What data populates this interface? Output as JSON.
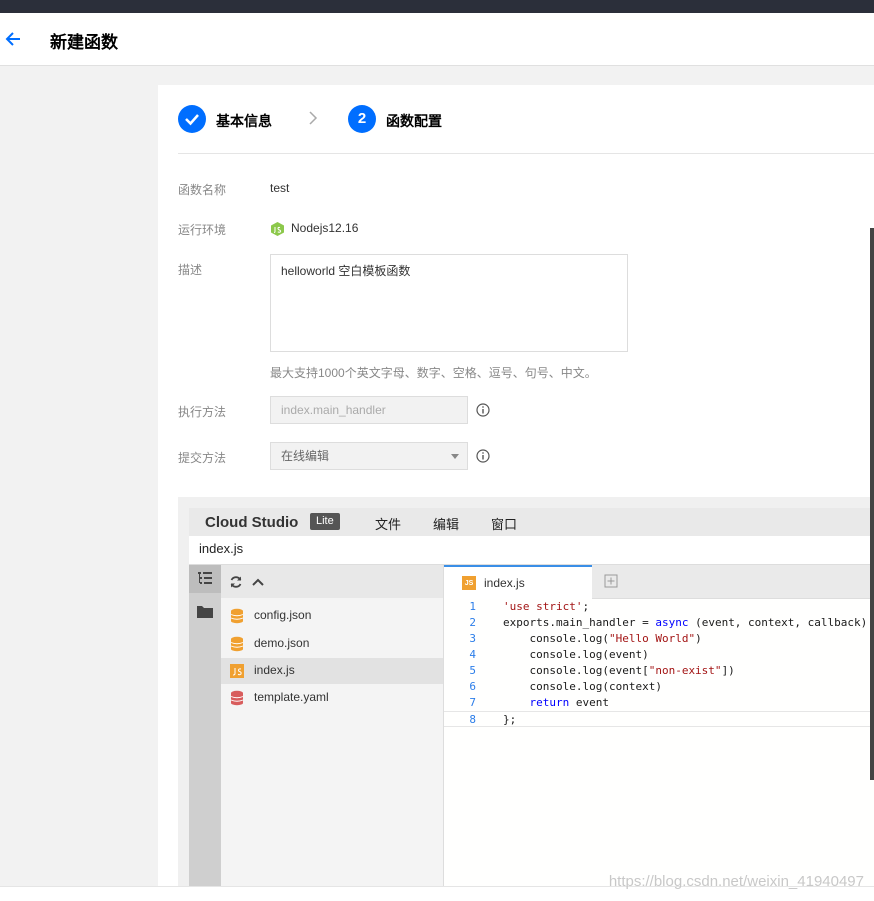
{
  "header": {
    "title": "新建函数"
  },
  "steps": [
    {
      "label": "基本信息",
      "state": "done"
    },
    {
      "number": "2",
      "label": "函数配置",
      "state": "active"
    }
  ],
  "form": {
    "name_label": "函数名称",
    "name_value": "test",
    "runtime_label": "运行环境",
    "runtime_value": "Nodejs12.16",
    "desc_label": "描述",
    "desc_value": "helloworld 空白模板函数",
    "desc_hint": "最大支持1000个英文字母、数字、空格、逗号、句号、中文。",
    "handler_label": "执行方法",
    "handler_placeholder": "index.main_handler",
    "submit_label": "提交方法",
    "submit_value": "在线编辑"
  },
  "ide": {
    "brand": "Cloud Studio",
    "badge": "Lite",
    "menus": [
      "文件",
      "编辑",
      "窗口"
    ],
    "current_file": "index.js",
    "files": [
      {
        "name": "config.json",
        "type": "db",
        "color": "#f0a030"
      },
      {
        "name": "demo.json",
        "type": "db",
        "color": "#f0a030"
      },
      {
        "name": "index.js",
        "type": "js",
        "color": "#f0a030",
        "active": true
      },
      {
        "name": "template.yaml",
        "type": "db",
        "color": "#d85c5c"
      }
    ],
    "tab": {
      "label": "index.js",
      "icon": "JS"
    },
    "code_lines": [
      "1",
      "2",
      "3",
      "4",
      "5",
      "6",
      "7",
      "8"
    ]
  },
  "watermark": "https://blog.csdn.net/weixin_41940497"
}
